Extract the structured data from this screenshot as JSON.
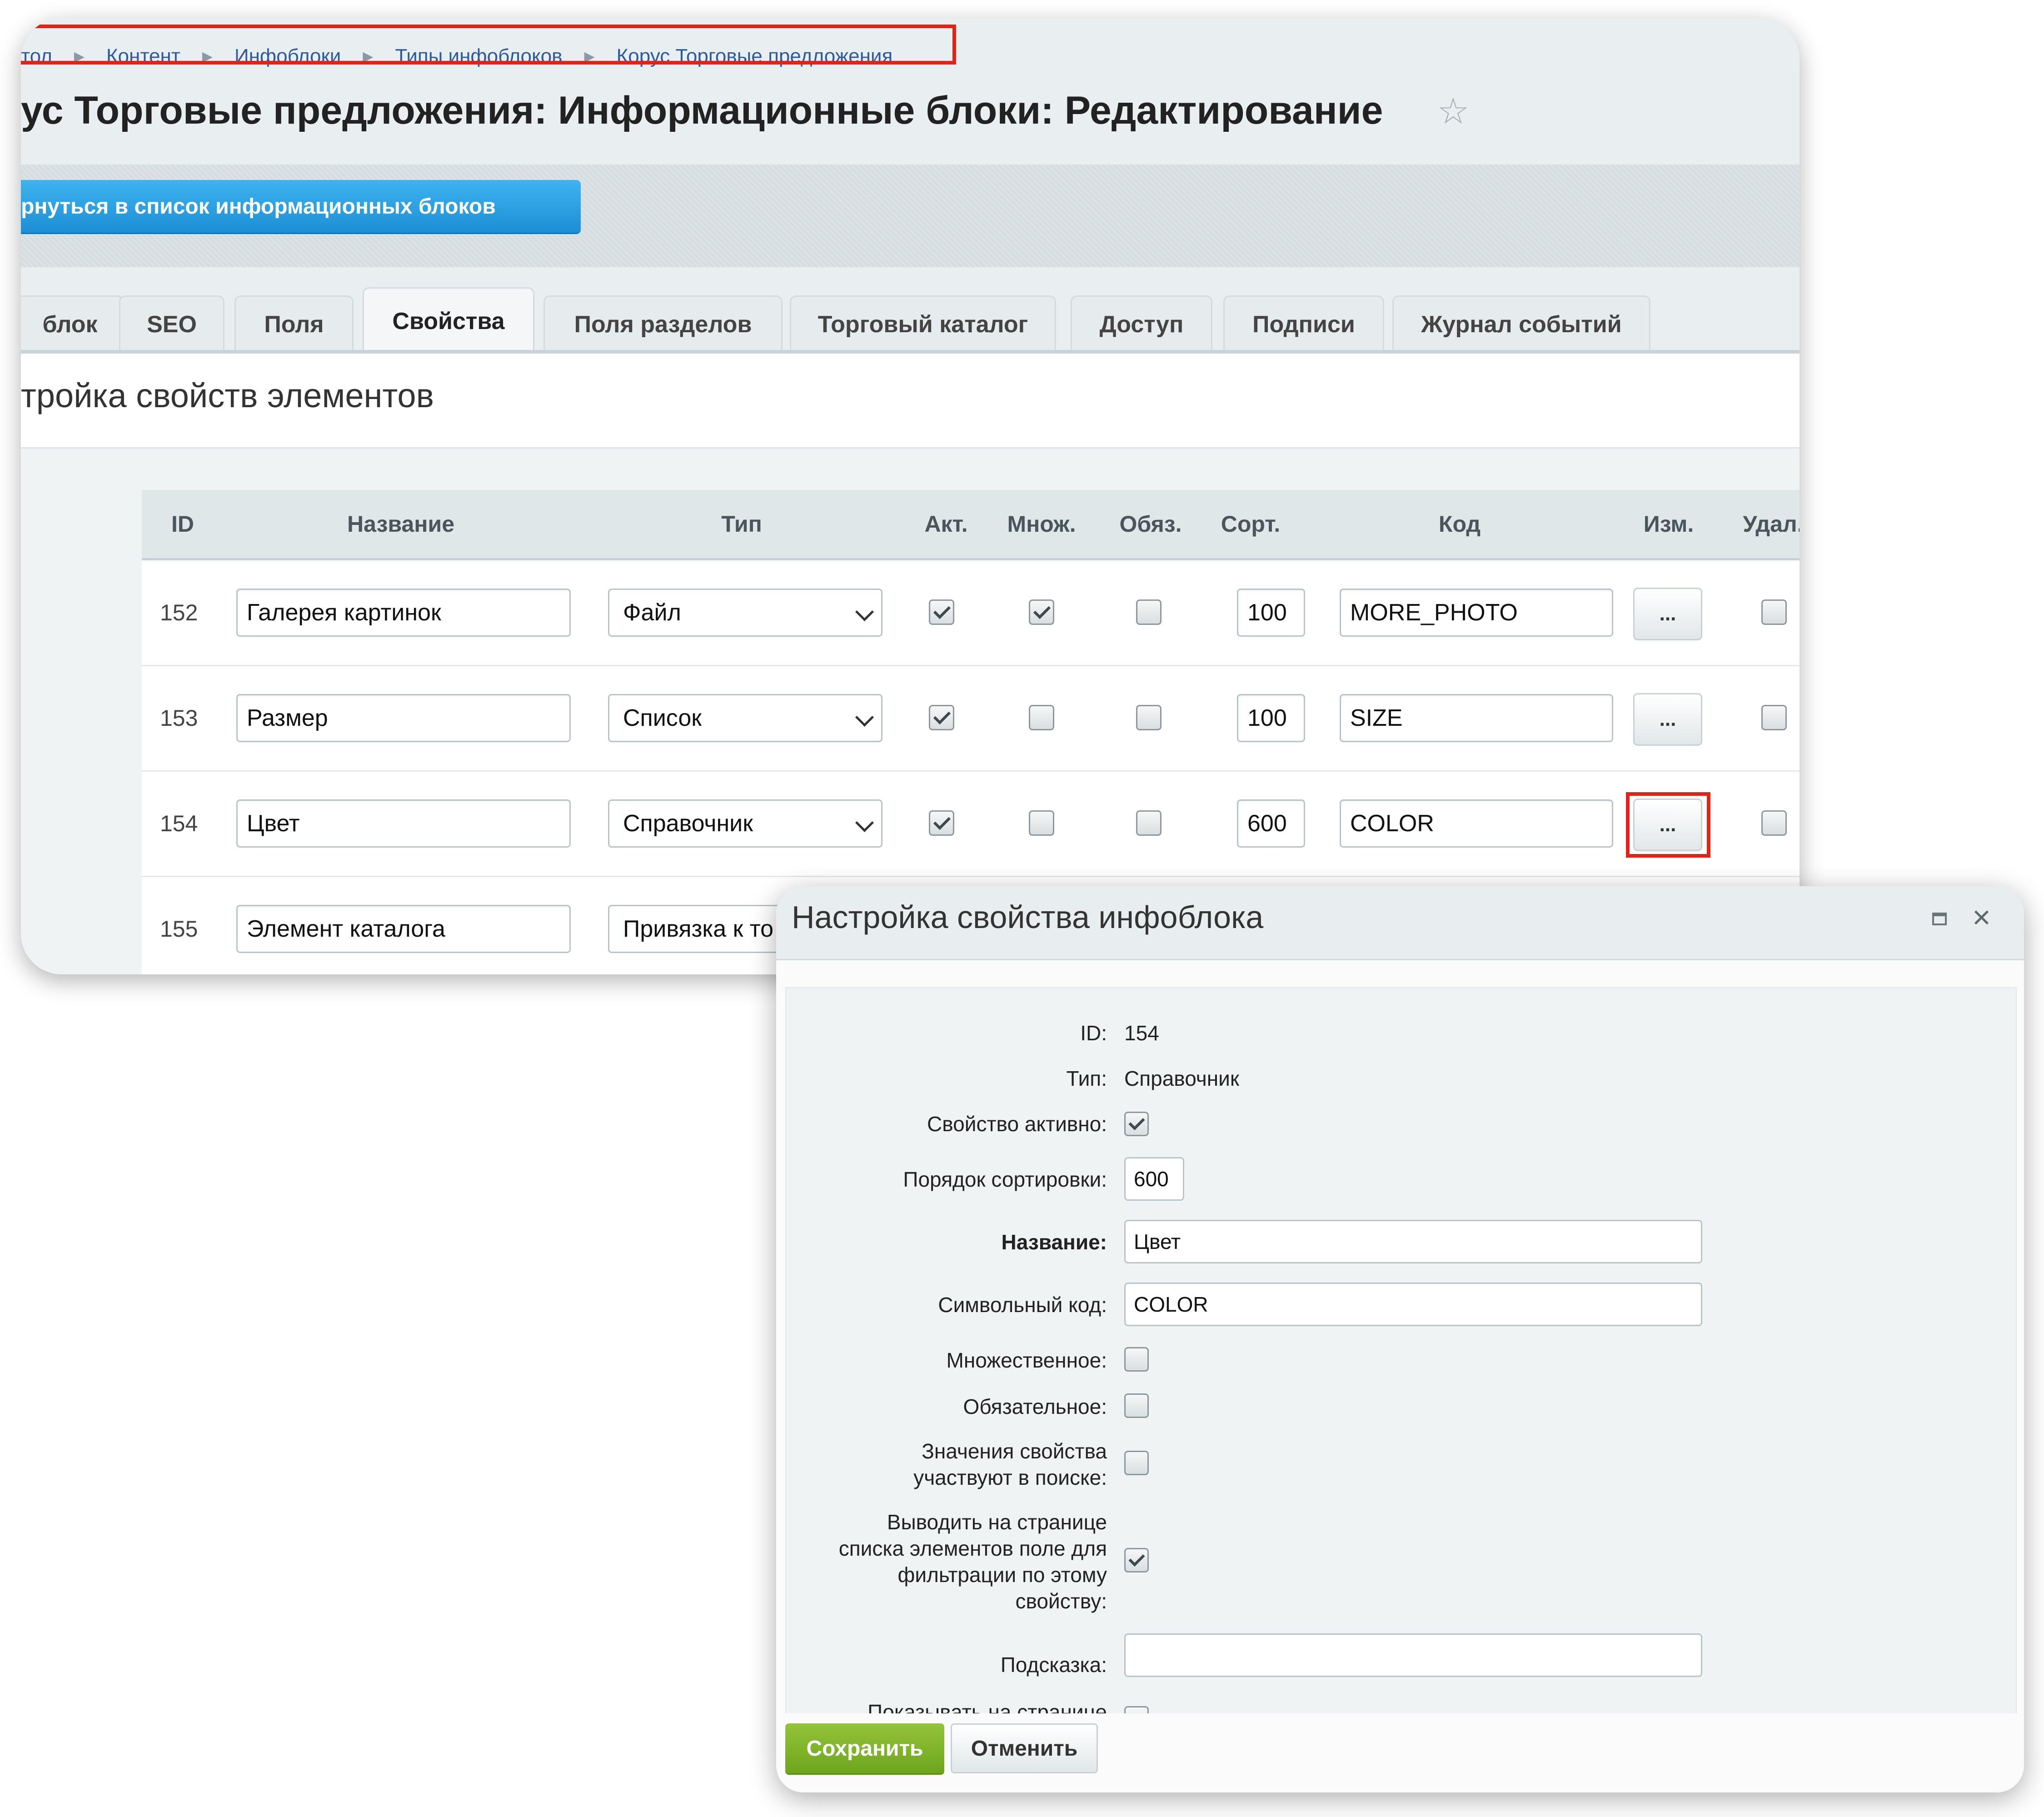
{
  "breadcrumbs": [
    "тол",
    "Контент",
    "Инфоблоки",
    "Типы инфоблоков",
    "Корус Торговые предложения"
  ],
  "page_title": "ус Торговые предложения: Информационные блоки: Редактирование",
  "back_button": "рнуться в список информационных блоков",
  "tabs": [
    "блок",
    "SEO",
    "Поля",
    "Свойства",
    "Поля разделов",
    "Торговый каталог",
    "Доступ",
    "Подписи",
    "Журнал событий"
  ],
  "active_tab": "Свойства",
  "section_title": "тройка свойств элементов",
  "table": {
    "headers": [
      "ID",
      "Название",
      "Тип",
      "Акт.",
      "Множ.",
      "Обяз.",
      "Сорт.",
      "Код",
      "Изм.",
      "Удал."
    ],
    "edit_label": "...",
    "rows": [
      {
        "id": "152",
        "name": "Галерея картинок",
        "type": "Файл",
        "active": true,
        "multiple": true,
        "required": false,
        "sort": "100",
        "code": "MORE_PHOTO"
      },
      {
        "id": "153",
        "name": "Размер",
        "type": "Список",
        "active": true,
        "multiple": false,
        "required": false,
        "sort": "100",
        "code": "SIZE"
      },
      {
        "id": "154",
        "name": "Цвет",
        "type": "Справочник",
        "active": true,
        "multiple": false,
        "required": false,
        "sort": "600",
        "code": "COLOR"
      },
      {
        "id": "155",
        "name": "Элемент каталога",
        "type": "Привязка к то",
        "active": null,
        "multiple": null,
        "required": null,
        "sort": "",
        "code": ""
      }
    ]
  },
  "dialog": {
    "title": "Настройка свойства инфоблока",
    "id_label": "ID:",
    "id_value": "154",
    "type_label": "Тип:",
    "type_value": "Справочник",
    "active_label": "Свойство активно:",
    "active": true,
    "sort_label": "Порядок сортировки:",
    "sort_value": "600",
    "name_label": "Название:",
    "name_value": "Цвет",
    "code_label": "Символьный код:",
    "code_value": "COLOR",
    "multiple_label": "Множественное:",
    "multiple": false,
    "required_label": "Обязательное:",
    "required": false,
    "search_label_1": "Значения свойства",
    "search_label_2": "участвуют в поиске:",
    "search": false,
    "filter_label_1": "Выводить на странице",
    "filter_label_2": "списка элементов поле для",
    "filter_label_3": "фильтрации по этому",
    "filter_label_4": "свойству:",
    "filter": true,
    "hint_label": "Подсказка:",
    "hint_value": "",
    "cut_label": "Показывать на странице",
    "save_button": "Сохранить",
    "cancel_button": "Отменить"
  },
  "colors": {
    "accent_blue": "#1c8fd6",
    "save_green": "#7ab12a",
    "highlight_red": "#e2231a",
    "link": "#2e5c99"
  },
  "icons": [
    "star-icon",
    "maximize-icon",
    "close-icon",
    "chevron-down-icon",
    "breadcrumb-arrow-icon"
  ]
}
